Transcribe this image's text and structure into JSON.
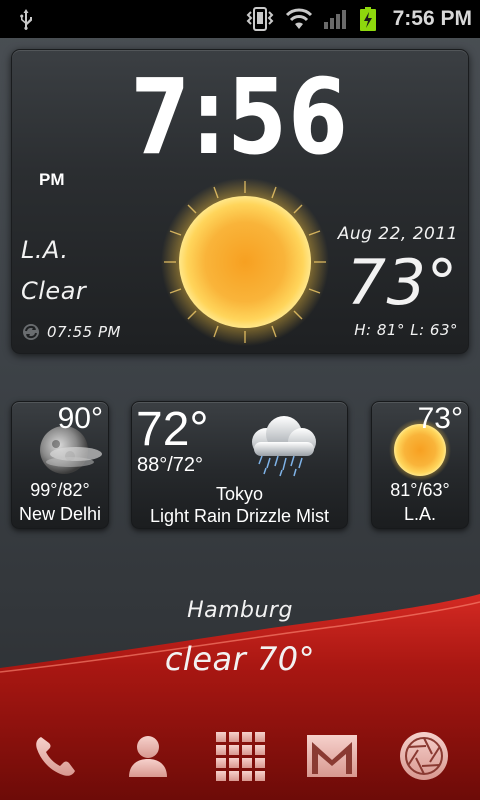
{
  "status_bar": {
    "time": "7:56 PM",
    "icons": [
      "usb-icon",
      "vibrate-icon",
      "wifi-icon",
      "signal-icon",
      "battery-charging-icon"
    ],
    "battery_color": "#8ed80d"
  },
  "clock_widget": {
    "time": "7:56",
    "ampm": "PM",
    "city": "L.A.",
    "condition": "Clear",
    "updated": "07:55 PM",
    "date": "Aug 22, 2011",
    "temperature": "73°",
    "hi_lo": "H: 81°  L: 63°",
    "icon": "sun-icon"
  },
  "widgets": [
    {
      "temperature": "90°",
      "range": "99°/82°",
      "city": "New Delhi",
      "icon": "night-fog-icon"
    },
    {
      "temperature": "72°",
      "range": "88°/72°",
      "city": "Tokyo",
      "condition": "Light Rain Drizzle Mist",
      "icon": "rain-cloud-icon"
    },
    {
      "temperature": "73°",
      "range": "81°/63°",
      "city": "L.A.",
      "icon": "sun-icon"
    }
  ],
  "hamburg": {
    "city": "Hamburg",
    "condition": "clear 70°"
  },
  "dock": [
    {
      "name": "phone",
      "icon": "phone-icon"
    },
    {
      "name": "contacts",
      "icon": "contacts-icon"
    },
    {
      "name": "apps",
      "icon": "app-drawer-icon"
    },
    {
      "name": "gmail",
      "icon": "gmail-icon"
    },
    {
      "name": "camera",
      "icon": "camera-shutter-icon"
    }
  ],
  "colors": {
    "accent_red": "#b21612",
    "dock_icon": "#e8b6b0",
    "sun_core": "#f5a623"
  }
}
